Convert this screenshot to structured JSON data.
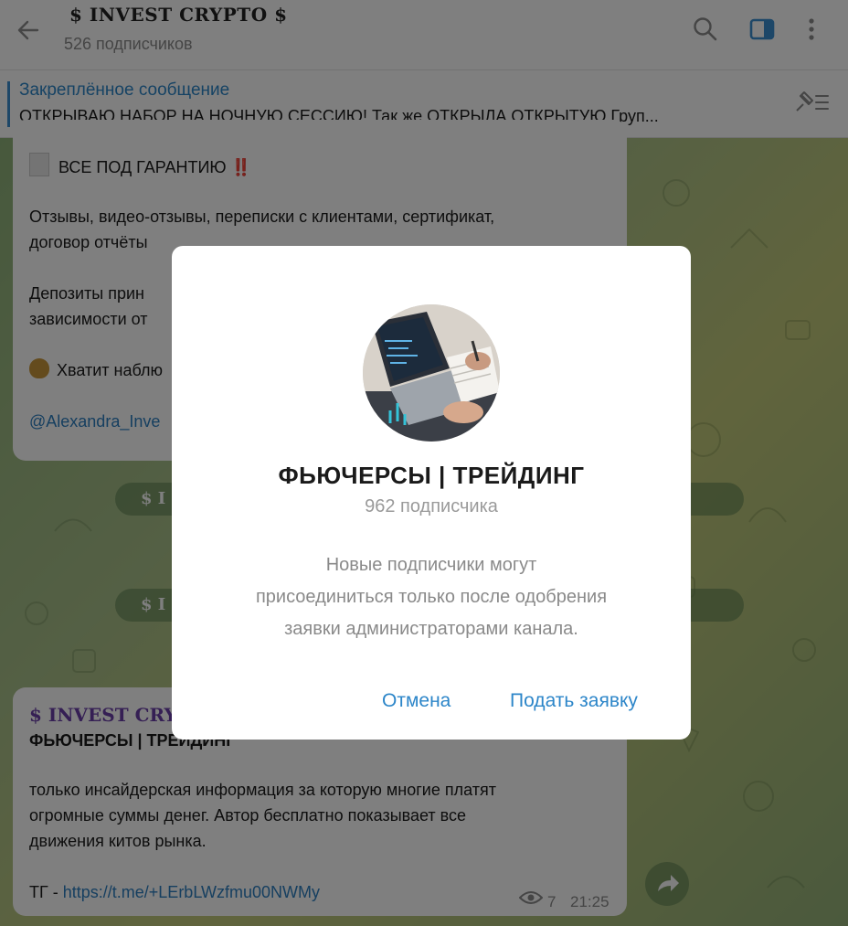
{
  "header": {
    "title": "$ INVEST CRYPTO $",
    "subscribers": "526 подписчиков",
    "icons": [
      "back-arrow-icon",
      "search-icon",
      "sidebar-toggle-icon",
      "more-vertical-icon"
    ],
    "accent_color": "#3a8fd0"
  },
  "pinned": {
    "title": "Закреплённое сообщение",
    "text": "ОТКРЫВАЮ НАБОР НА НОЧНУЮ СЕССИЮ!    Так  же  ОТКРЫЛА ОТКРЫТУЮ  Груп...",
    "icon": "pin-list-icon"
  },
  "messages": {
    "first": {
      "line_guarantee": "ВСЕ ПОД ГАРАНТИЮ",
      "guarantee_mark": "‼️",
      "line_reviews_1": "Отзывы, видео-отзывы, переписки с клиентами, сертификат,",
      "line_reviews_2": "договор  отчёты",
      "line_deposit_1": "Депозиты  прин",
      "line_deposit_2": "зависимости от",
      "line_enough": "Хватит наблю",
      "mention": "@Alexandra_Inve"
    },
    "service_1": "$ I",
    "service_2": "$ I",
    "second": {
      "channel_name": "$ INVEST CRYPT",
      "subtitle": "ФЬЮЧЕРСЫ | ТРЕЙДИНГ",
      "body_1": "только инсайдерская информация за которую многие платят",
      "body_2": "огромные суммы денег. Автор бесплатно показывает все",
      "body_3": "движения китов рынка.",
      "tg_label": "ТГ - ",
      "tg_link": "https://t.me/+LErbLWzfmu00NWMy",
      "views": "7",
      "time": "21:25"
    }
  },
  "dialog": {
    "title": "ФЬЮЧЕРСЫ | ТРЕЙДИНГ",
    "subscribers": "962 подписчика",
    "description_1": "Новые подписчики могут",
    "description_2": "присоединиться только после одобрения",
    "description_3": "заявки администраторами канала.",
    "cancel_label": "Отмена",
    "submit_label": "Подать заявку"
  }
}
